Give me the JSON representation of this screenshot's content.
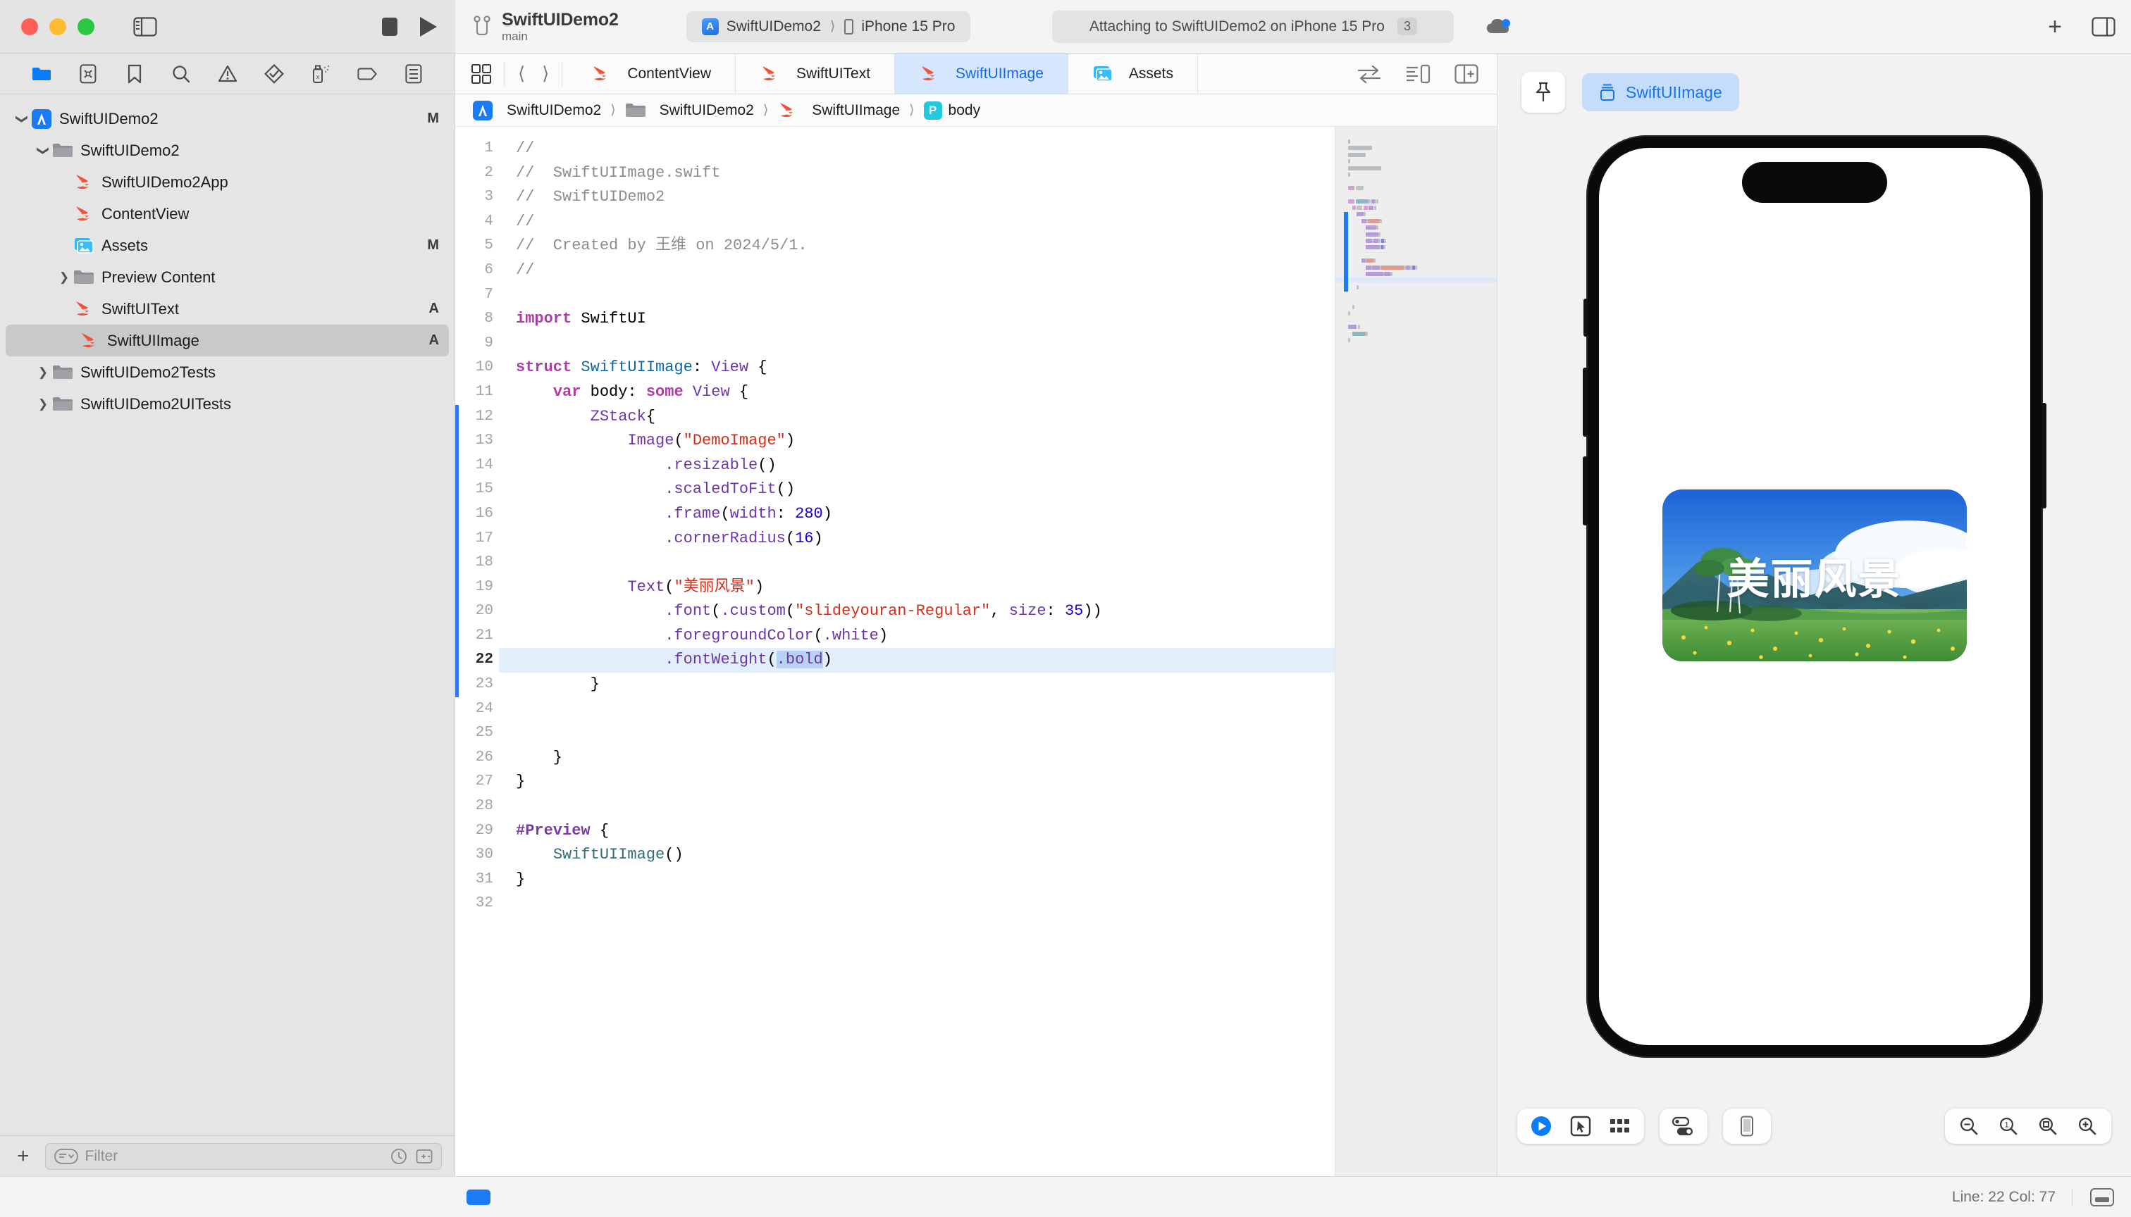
{
  "window": {
    "traffic_lights": [
      "close",
      "minimize",
      "zoom"
    ],
    "project_name": "SwiftUIDemo2",
    "branch": "main",
    "scheme": {
      "target": "SwiftUIDemo2",
      "destination": "iPhone 15 Pro"
    },
    "status": {
      "message": "Attaching to SwiftUIDemo2 on iPhone 15 Pro",
      "badge": "3"
    }
  },
  "navigator": {
    "tabs": [
      {
        "name": "project-navigator",
        "icon": "folder-icon",
        "active": true
      },
      {
        "name": "source-control-navigator",
        "icon": "source-control-icon",
        "active": false
      },
      {
        "name": "bookmarks-navigator",
        "icon": "bookmark-icon",
        "active": false
      },
      {
        "name": "find-navigator",
        "icon": "search-icon",
        "active": false
      },
      {
        "name": "issue-navigator",
        "icon": "warning-icon",
        "active": false
      },
      {
        "name": "test-navigator",
        "icon": "diamond-check-icon",
        "active": false
      },
      {
        "name": "debug-navigator",
        "icon": "spray-icon",
        "active": false
      },
      {
        "name": "breakpoint-navigator",
        "icon": "tag-icon",
        "active": false
      },
      {
        "name": "report-navigator",
        "icon": "report-icon",
        "active": false
      }
    ],
    "items": [
      {
        "label": "SwiftUIDemo2",
        "icon": "xcode-project-icon",
        "indent": 0,
        "disclosure": "open",
        "status": "M",
        "selected": false
      },
      {
        "label": "SwiftUIDemo2",
        "icon": "folder-icon",
        "indent": 1,
        "disclosure": "open",
        "status": "",
        "selected": false
      },
      {
        "label": "SwiftUIDemo2App",
        "icon": "swift-file-icon",
        "indent": 2,
        "disclosure": "none",
        "status": "",
        "selected": false
      },
      {
        "label": "ContentView",
        "icon": "swift-file-icon",
        "indent": 2,
        "disclosure": "none",
        "status": "",
        "selected": false
      },
      {
        "label": "Assets",
        "icon": "assets-icon",
        "indent": 2,
        "disclosure": "none",
        "status": "M",
        "selected": false
      },
      {
        "label": "Preview Content",
        "icon": "folder-icon",
        "indent": 2,
        "disclosure": "closed",
        "status": "",
        "selected": false
      },
      {
        "label": "SwiftUIText",
        "icon": "swift-file-icon",
        "indent": 2,
        "disclosure": "none",
        "status": "A",
        "selected": false
      },
      {
        "label": "SwiftUIImage",
        "icon": "swift-file-icon",
        "indent": 2,
        "disclosure": "none",
        "status": "A",
        "selected": true
      },
      {
        "label": "SwiftUIDemo2Tests",
        "icon": "folder-icon",
        "indent": 1,
        "disclosure": "closed",
        "status": "",
        "selected": false
      },
      {
        "label": "SwiftUIDemo2UITests",
        "icon": "folder-icon",
        "indent": 1,
        "disclosure": "closed",
        "status": "",
        "selected": false
      }
    ],
    "filter": {
      "placeholder": "Filter",
      "add_label": "+"
    }
  },
  "editor": {
    "tabs": [
      {
        "label": "ContentView",
        "icon": "swift-file-icon",
        "active": false
      },
      {
        "label": "SwiftUIText",
        "icon": "swift-file-icon",
        "active": false
      },
      {
        "label": "SwiftUIImage",
        "icon": "swift-file-icon",
        "active": true
      },
      {
        "label": "Assets",
        "icon": "assets-icon",
        "active": false
      }
    ],
    "breadcrumb": [
      {
        "label": "SwiftUIDemo2",
        "icon": "xcode-project-icon"
      },
      {
        "label": "SwiftUIDemo2",
        "icon": "folder-icon"
      },
      {
        "label": "SwiftUIImage",
        "icon": "swift-file-icon"
      },
      {
        "label": "body",
        "icon": "body-badge-icon"
      }
    ],
    "current_line": 22,
    "code_lines": [
      {
        "n": 1,
        "tokens": [
          {
            "t": "//",
            "c": "cmt"
          }
        ]
      },
      {
        "n": 2,
        "tokens": [
          {
            "t": "//  SwiftUIImage.swift",
            "c": "cmt"
          }
        ]
      },
      {
        "n": 3,
        "tokens": [
          {
            "t": "//  SwiftUIDemo2",
            "c": "cmt"
          }
        ]
      },
      {
        "n": 4,
        "tokens": [
          {
            "t": "//",
            "c": "cmt"
          }
        ]
      },
      {
        "n": 5,
        "tokens": [
          {
            "t": "//  Created by 王维 on 2024/5/1.",
            "c": "cmt"
          }
        ]
      },
      {
        "n": 6,
        "tokens": [
          {
            "t": "//",
            "c": "cmt"
          }
        ]
      },
      {
        "n": 7,
        "tokens": []
      },
      {
        "n": 8,
        "tokens": [
          {
            "t": "import",
            "c": "kw"
          },
          {
            "t": " SwiftUI",
            "c": "plain"
          }
        ]
      },
      {
        "n": 9,
        "tokens": []
      },
      {
        "n": 10,
        "tokens": [
          {
            "t": "struct",
            "c": "kw"
          },
          {
            "t": " ",
            "c": "plain"
          },
          {
            "t": "SwiftUIImage",
            "c": "type"
          },
          {
            "t": ": ",
            "c": "plain"
          },
          {
            "t": "View",
            "c": "mem"
          },
          {
            "t": " {",
            "c": "plain"
          }
        ]
      },
      {
        "n": 11,
        "tokens": [
          {
            "t": "    ",
            "c": "plain"
          },
          {
            "t": "var",
            "c": "kw"
          },
          {
            "t": " body: ",
            "c": "plain"
          },
          {
            "t": "some",
            "c": "kw"
          },
          {
            "t": " ",
            "c": "plain"
          },
          {
            "t": "View",
            "c": "mem"
          },
          {
            "t": " {",
            "c": "plain"
          }
        ]
      },
      {
        "n": 12,
        "tokens": [
          {
            "t": "        ",
            "c": "plain"
          },
          {
            "t": "ZStack",
            "c": "mem"
          },
          {
            "t": "{",
            "c": "plain"
          }
        ]
      },
      {
        "n": 13,
        "tokens": [
          {
            "t": "            ",
            "c": "plain"
          },
          {
            "t": "Image",
            "c": "mem"
          },
          {
            "t": "(",
            "c": "plain"
          },
          {
            "t": "\"DemoImage\"",
            "c": "str"
          },
          {
            "t": ")",
            "c": "plain"
          }
        ]
      },
      {
        "n": 14,
        "tokens": [
          {
            "t": "                ",
            "c": "plain"
          },
          {
            "t": ".resizable",
            "c": "mem"
          },
          {
            "t": "()",
            "c": "plain"
          }
        ]
      },
      {
        "n": 15,
        "tokens": [
          {
            "t": "                ",
            "c": "plain"
          },
          {
            "t": ".scaledToFit",
            "c": "mem"
          },
          {
            "t": "()",
            "c": "plain"
          }
        ]
      },
      {
        "n": 16,
        "tokens": [
          {
            "t": "                ",
            "c": "plain"
          },
          {
            "t": ".frame",
            "c": "mem"
          },
          {
            "t": "(",
            "c": "plain"
          },
          {
            "t": "width",
            "c": "mem"
          },
          {
            "t": ": ",
            "c": "plain"
          },
          {
            "t": "280",
            "c": "num"
          },
          {
            "t": ")",
            "c": "plain"
          }
        ]
      },
      {
        "n": 17,
        "tokens": [
          {
            "t": "                ",
            "c": "plain"
          },
          {
            "t": ".cornerRadius",
            "c": "mem"
          },
          {
            "t": "(",
            "c": "plain"
          },
          {
            "t": "16",
            "c": "num"
          },
          {
            "t": ")",
            "c": "plain"
          }
        ]
      },
      {
        "n": 18,
        "tokens": []
      },
      {
        "n": 19,
        "tokens": [
          {
            "t": "            ",
            "c": "plain"
          },
          {
            "t": "Text",
            "c": "mem"
          },
          {
            "t": "(",
            "c": "plain"
          },
          {
            "t": "\"美丽风景\"",
            "c": "str"
          },
          {
            "t": ")",
            "c": "plain"
          }
        ]
      },
      {
        "n": 20,
        "tokens": [
          {
            "t": "                ",
            "c": "plain"
          },
          {
            "t": ".font",
            "c": "mem"
          },
          {
            "t": "(",
            "c": "plain"
          },
          {
            "t": ".custom",
            "c": "mem"
          },
          {
            "t": "(",
            "c": "plain"
          },
          {
            "t": "\"slideyouran-Regular\"",
            "c": "str"
          },
          {
            "t": ", ",
            "c": "plain"
          },
          {
            "t": "size",
            "c": "mem"
          },
          {
            "t": ": ",
            "c": "plain"
          },
          {
            "t": "35",
            "c": "num"
          },
          {
            "t": "))",
            "c": "plain"
          }
        ]
      },
      {
        "n": 21,
        "tokens": [
          {
            "t": "                ",
            "c": "plain"
          },
          {
            "t": ".foregroundColor",
            "c": "mem"
          },
          {
            "t": "(",
            "c": "plain"
          },
          {
            "t": ".white",
            "c": "mem"
          },
          {
            "t": ")",
            "c": "plain"
          }
        ]
      },
      {
        "n": 22,
        "tokens": [
          {
            "t": "                ",
            "c": "plain"
          },
          {
            "t": ".fontWeight",
            "c": "mem"
          },
          {
            "t": "(",
            "c": "plain"
          },
          {
            "t": ".bold",
            "c": "mem",
            "sel": true
          },
          {
            "t": ")",
            "c": "plain"
          }
        ]
      },
      {
        "n": 23,
        "tokens": [
          {
            "t": "        }",
            "c": "plain"
          }
        ]
      },
      {
        "n": 24,
        "tokens": []
      },
      {
        "n": 25,
        "tokens": []
      },
      {
        "n": 26,
        "tokens": [
          {
            "t": "    }",
            "c": "plain"
          }
        ]
      },
      {
        "n": 27,
        "tokens": [
          {
            "t": "}",
            "c": "plain"
          }
        ]
      },
      {
        "n": 28,
        "tokens": []
      },
      {
        "n": 29,
        "tokens": [
          {
            "t": "#Preview",
            "c": "dir"
          },
          {
            "t": " {",
            "c": "plain"
          }
        ]
      },
      {
        "n": 30,
        "tokens": [
          {
            "t": "    ",
            "c": "plain"
          },
          {
            "t": "SwiftUIImage",
            "c": "fn"
          },
          {
            "t": "()",
            "c": "plain"
          }
        ]
      },
      {
        "n": 31,
        "tokens": [
          {
            "t": "}",
            "c": "plain"
          }
        ]
      },
      {
        "n": 32,
        "tokens": []
      }
    ]
  },
  "preview": {
    "pin_label": "pin-icon",
    "chip_label": "SwiftUIImage",
    "device": "iPhone 15 Pro",
    "rendered_text": "美丽风景",
    "controls": [
      {
        "name": "live-preview-button",
        "icon": "play-circle-icon"
      },
      {
        "name": "selectable-preview-button",
        "icon": "cursor-box-icon"
      },
      {
        "name": "variants-button",
        "icon": "grid-dots-icon"
      },
      {
        "name": "device-settings-button",
        "icon": "toggles-icon"
      },
      {
        "name": "device-frame-button",
        "icon": "phone-icon"
      }
    ],
    "zoom_controls": [
      {
        "name": "zoom-out-button",
        "icon": "magnifier-minus-icon"
      },
      {
        "name": "zoom-100-button",
        "icon": "magnifier-one-icon"
      },
      {
        "name": "zoom-fit-button",
        "icon": "magnifier-fit-icon"
      },
      {
        "name": "zoom-in-button",
        "icon": "magnifier-plus-icon"
      }
    ]
  },
  "statusbar": {
    "line_col": "Line: 22  Col: 77"
  }
}
